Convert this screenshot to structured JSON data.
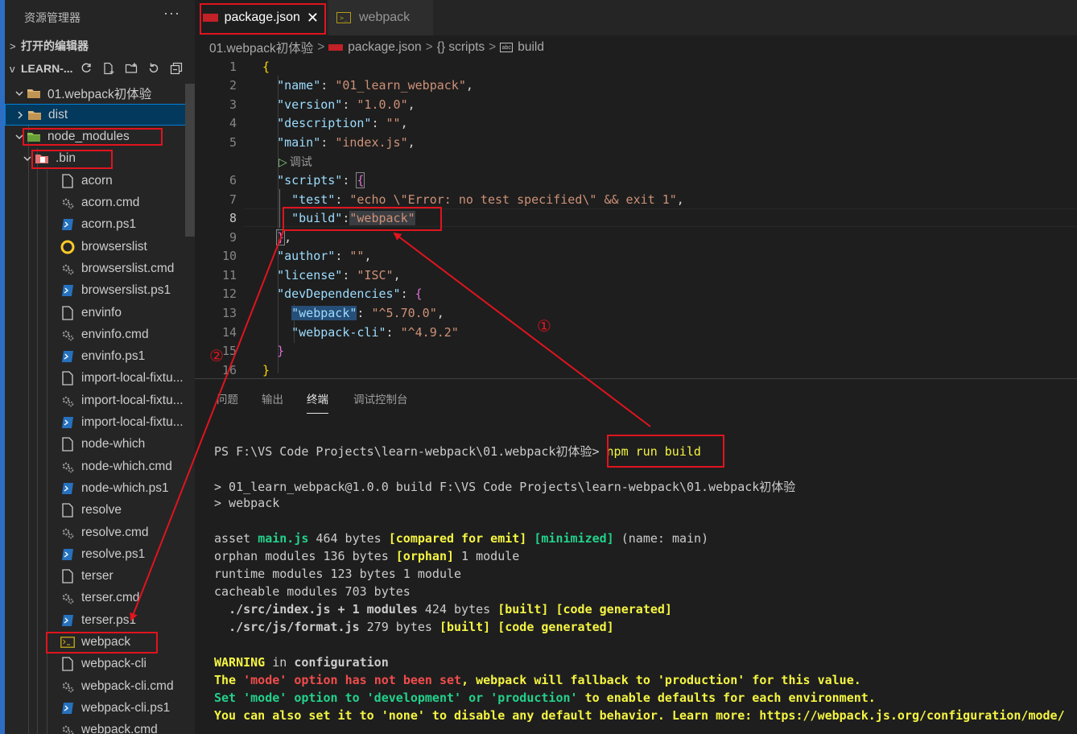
{
  "sidebar": {
    "title": "资源管理器",
    "more": "···",
    "open_editors": "打开的编辑器",
    "workspace": "LEARN-...",
    "tree": [
      {
        "label": "01.webpack初体验",
        "icon": "folder-icon",
        "chev": "v"
      },
      {
        "label": "dist",
        "icon": "folder-icon",
        "chev": ">"
      },
      {
        "label": "node_modules",
        "icon": "folder-node-icon",
        "chev": "v"
      },
      {
        "label": ".bin",
        "icon": "folder-bin-icon",
        "chev": "v"
      },
      {
        "label": "acorn",
        "icon": "file-icon"
      },
      {
        "label": "acorn.cmd",
        "icon": "gear-icon"
      },
      {
        "label": "acorn.ps1",
        "icon": "powershell-icon"
      },
      {
        "label": "browserslist",
        "icon": "browserslist-icon"
      },
      {
        "label": "browserslist.cmd",
        "icon": "gear-icon"
      },
      {
        "label": "browserslist.ps1",
        "icon": "powershell-icon"
      },
      {
        "label": "envinfo",
        "icon": "file-icon"
      },
      {
        "label": "envinfo.cmd",
        "icon": "gear-icon"
      },
      {
        "label": "envinfo.ps1",
        "icon": "powershell-icon"
      },
      {
        "label": "import-local-fixtu...",
        "icon": "file-icon"
      },
      {
        "label": "import-local-fixtu...",
        "icon": "gear-icon"
      },
      {
        "label": "import-local-fixtu...",
        "icon": "powershell-icon"
      },
      {
        "label": "node-which",
        "icon": "file-icon"
      },
      {
        "label": "node-which.cmd",
        "icon": "gear-icon"
      },
      {
        "label": "node-which.ps1",
        "icon": "powershell-icon"
      },
      {
        "label": "resolve",
        "icon": "file-icon"
      },
      {
        "label": "resolve.cmd",
        "icon": "gear-icon"
      },
      {
        "label": "resolve.ps1",
        "icon": "powershell-icon"
      },
      {
        "label": "terser",
        "icon": "file-icon"
      },
      {
        "label": "terser.cmd",
        "icon": "gear-icon"
      },
      {
        "label": "terser.ps1",
        "icon": "powershell-icon"
      },
      {
        "label": "webpack",
        "icon": "terminal-file-icon"
      },
      {
        "label": "webpack-cli",
        "icon": "file-icon"
      },
      {
        "label": "webpack-cli.cmd",
        "icon": "gear-icon"
      },
      {
        "label": "webpack-cli.ps1",
        "icon": "powershell-icon"
      },
      {
        "label": "webpack.cmd",
        "icon": "gear-icon"
      }
    ]
  },
  "tabs": [
    {
      "label": "package.json",
      "icon": "npm-icon",
      "close": "✕"
    },
    {
      "label": "webpack",
      "icon": "terminal-file-icon"
    }
  ],
  "breadcrumb": [
    "01.webpack初体验",
    "package.json",
    "{} scripts",
    "build"
  ],
  "editor": {
    "codelens": "调试",
    "line_numbers": [
      "1",
      "2",
      "3",
      "4",
      "5",
      "6",
      "7",
      "8",
      "9",
      "10",
      "11",
      "12",
      "13",
      "14",
      "15",
      "16"
    ],
    "current_line": "8"
  },
  "panel": {
    "tabs": [
      "问题",
      "输出",
      "终端",
      "调试控制台"
    ],
    "active_tab": "终端"
  },
  "terminal": {
    "prompt": "PS F:\\VS Code Projects\\learn-webpack\\01.webpack初体验> ",
    "command": "npm run build",
    "line_run": "> 01_learn_webpack@1.0.0 build F:\\VS Code Projects\\learn-webpack\\01.webpack初体验",
    "line_webpack": "> webpack"
  },
  "annotations": {
    "marker1": "①",
    "marker2": "②"
  },
  "colors": {
    "annotation_red": "#e0141e",
    "selection": "#04395e",
    "accent": "#007fd4"
  }
}
